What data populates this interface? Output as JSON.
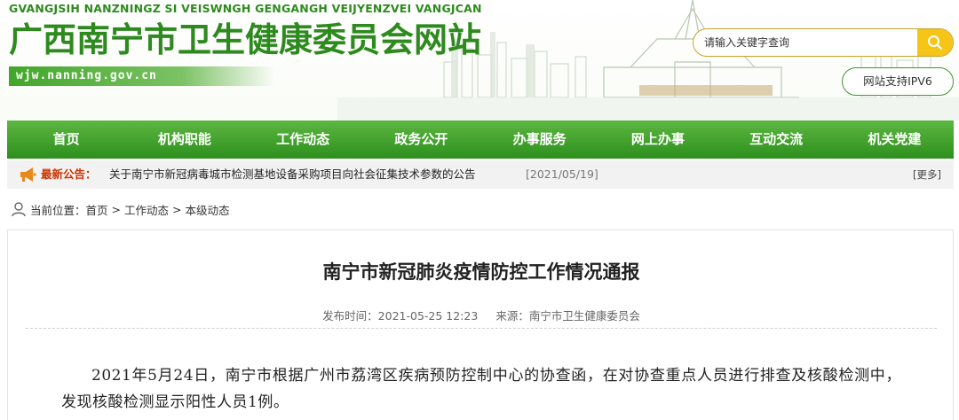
{
  "header": {
    "subtitle_pinyin": "GVANGJSIH NANZNINGZ SI VEISWNGH GENGANGH VEIJYENZVEI VANGJCAN",
    "site_title": "广西南宁市卫生健康委员会网站",
    "domain": "wjw.nanning.gov.cn",
    "search_placeholder": "请输入关键字查询",
    "ipv6_label": "网站支持IPV6",
    "brand_color": "#2e8a1f"
  },
  "nav": {
    "items": [
      {
        "label": "首页"
      },
      {
        "label": "机构职能"
      },
      {
        "label": "工作动态"
      },
      {
        "label": "政务公开"
      },
      {
        "label": "办事服务"
      },
      {
        "label": "网上办事"
      },
      {
        "label": "互动交流"
      },
      {
        "label": "机关党建"
      }
    ]
  },
  "notice": {
    "label": "最新公告：",
    "text": "关于南宁市新冠病毒城市检测基地设备采购项目向社会征集技术参数的公告",
    "date": "[2021/05/19]",
    "more": "[更多]"
  },
  "breadcrumb": {
    "prefix": "当前位置：",
    "items": [
      "首页",
      "工作动态",
      "本级动态"
    ],
    "separator": ">"
  },
  "article": {
    "title": "南宁市新冠肺炎疫情防控工作情况通报",
    "publish_label": "发布时间：",
    "publish_time": "2021-05-25 12:23",
    "source_label": "来源：",
    "source": "南宁市卫生健康委员会",
    "body": "2021年5月24日，南宁市根据广州市荔湾区疾病预防控制中心的协查函，在对协查重点人员进行排查及核酸检测中，发现核酸检测显示阳性人员1例。"
  }
}
